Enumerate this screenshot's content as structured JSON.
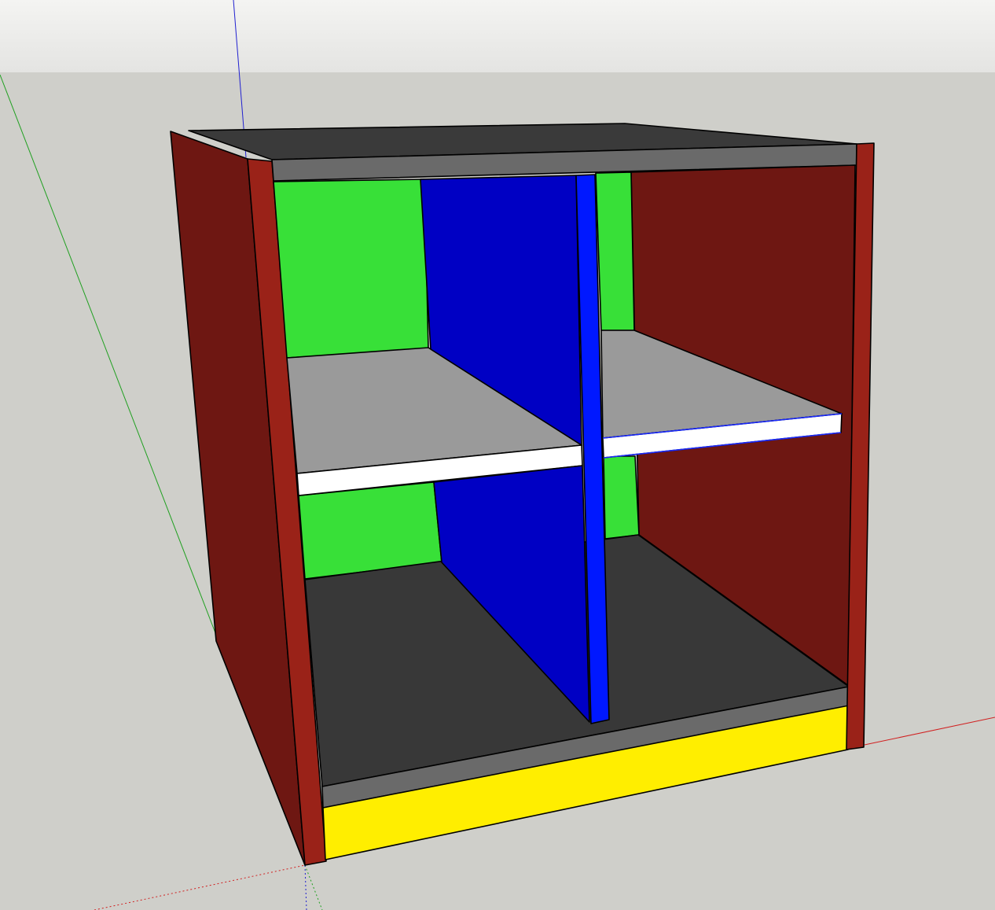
{
  "viewport": {
    "sky_color_top": "#f4f4f2",
    "sky_color_bottom": "#e4e4e2",
    "ground_color": "#cfcfca"
  },
  "axes": {
    "x_color": "#d02020",
    "y_color": "#20a020",
    "z_color": "#2020d0"
  },
  "model": {
    "name": "cabinet",
    "shelf_count": 2,
    "compartment_count": 4,
    "colors": {
      "outer_side": "#6e1712",
      "side_edge": "#9a2218",
      "inner_side": "#6e1712",
      "back_panel": "#38e038",
      "divider": "#0000c4",
      "divider_edge": "#0018ff",
      "shelf_top": "#9a9a9a",
      "shelf_edge": "#ffffff",
      "top_panel": "#3a3a3a",
      "top_edge": "#6a6a6a",
      "bottom_panel": "#383838",
      "bottom_edge": "#6a6a6a",
      "plinth": "#ffee00"
    }
  }
}
